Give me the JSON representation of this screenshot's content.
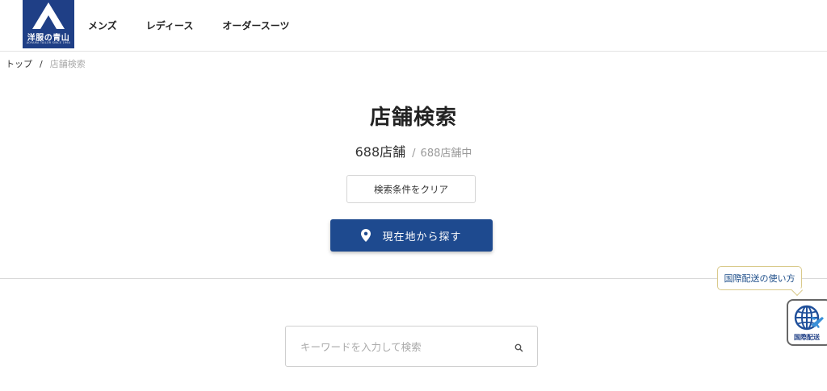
{
  "logo": {
    "text": "洋服の青山",
    "sub": "AOYAMA TAILOR SINCE 1964"
  },
  "nav": {
    "items": [
      "メンズ",
      "レディース",
      "オーダースーツ"
    ]
  },
  "breadcrumb": {
    "home": "トップ",
    "separator": "/",
    "current": "店舗検索"
  },
  "page": {
    "title": "店舗検索"
  },
  "store_count": {
    "shown": "688店舗",
    "separator": "/",
    "total": "688店舗中"
  },
  "buttons": {
    "clear": "検索条件をクリア",
    "current_location": "現在地から探す"
  },
  "international": {
    "tooltip": "国際配送の使い方",
    "label": "国際配送"
  },
  "search": {
    "placeholder": "キーワードを入力して検索",
    "value": ""
  },
  "colors": {
    "brand": "#1f3f86",
    "button": "#1e4a8f",
    "tooltip_border": "#d9c98a"
  }
}
